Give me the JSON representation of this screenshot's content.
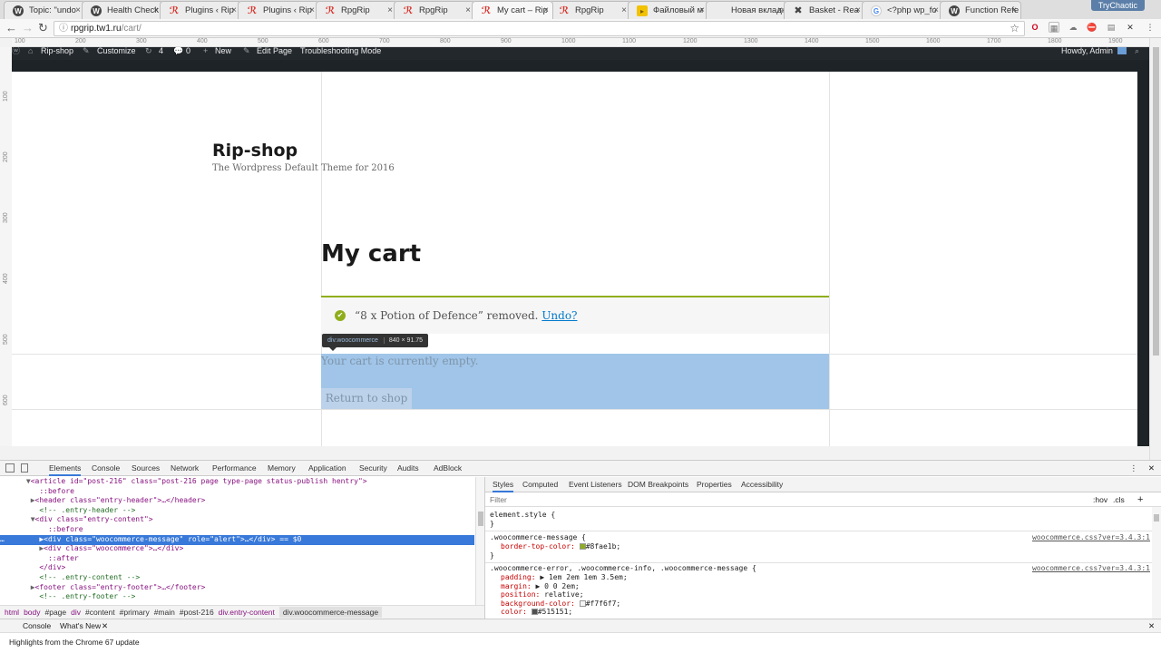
{
  "browser": {
    "tabs": [
      {
        "icon": "wp",
        "label": "Topic: \"undo"
      },
      {
        "icon": "wp",
        "label": "Health Check"
      },
      {
        "icon": "rr",
        "label": "Plugins ‹ Rip"
      },
      {
        "icon": "rr",
        "label": "Plugins ‹ Rip"
      },
      {
        "icon": "rr",
        "label": "RpgRip"
      },
      {
        "icon": "rr",
        "label": "RpgRip"
      },
      {
        "icon": "rr",
        "label": "My cart – Rip"
      },
      {
        "icon": "rr",
        "label": "RpgRip"
      },
      {
        "icon": "ff",
        "label": "Файловый м"
      },
      {
        "icon": "nt",
        "label": "Новая вкладка"
      },
      {
        "icon": "bx",
        "label": "Basket - Rea"
      },
      {
        "icon": "g",
        "label": "<?php wp_fo"
      },
      {
        "icon": "wp",
        "label": "Function Refe"
      }
    ],
    "active_tab_index": 6,
    "user": "TryChaotic",
    "url_host": "rpgrip.tw1.ru",
    "url_path": "/cart/"
  },
  "ruler": {
    "h_ticks": [
      "100",
      "200",
      "300",
      "400",
      "500",
      "600",
      "700",
      "800",
      "900",
      "1000",
      "1100",
      "1200",
      "1300",
      "1400",
      "1500",
      "1600",
      "1700",
      "1800",
      "1900"
    ],
    "v_ticks": [
      "100",
      "200",
      "300",
      "400",
      "500",
      "600"
    ]
  },
  "admin_bar": {
    "site": "Rip-shop",
    "customize": "Customize",
    "updates": "4",
    "comments": "0",
    "new": "New",
    "edit": "Edit Page",
    "troubleshoot": "Troubleshooting Mode",
    "howdy": "Howdy, Admin"
  },
  "site": {
    "title": "Rip-shop",
    "tagline": "The Wordpress Default Theme for 2016"
  },
  "page": {
    "title": "My cart",
    "message_text": "“8 x Potion of Defence” removed.",
    "message_link": "Undo?",
    "empty_text": "Your cart is currently empty.",
    "return_button": "Return to shop"
  },
  "inspect_tooltip": {
    "selector": "div.woocommerce",
    "size": "840 × 91.75"
  },
  "devtools": {
    "tabs": [
      "Elements",
      "Console",
      "Sources",
      "Network",
      "Performance",
      "Memory",
      "Application",
      "Security",
      "Audits",
      "AdBlock"
    ],
    "active_tab": "Elements",
    "dom_lines": [
      {
        "indent": "      ",
        "arrow": "▼",
        "text": "<article id=\"post-216\" class=\"post-216 page type-page status-publish hentry\">",
        "sel": false
      },
      {
        "indent": "        ",
        "arrow": " ",
        "text": "::before",
        "sel": false
      },
      {
        "indent": "       ",
        "arrow": "▶",
        "text": "<header class=\"entry-header\">…</header>",
        "sel": false
      },
      {
        "indent": "        ",
        "arrow": " ",
        "text": "<!-- .entry-header -->",
        "sel": false
      },
      {
        "indent": "       ",
        "arrow": "▼",
        "text": "<div class=\"entry-content\">",
        "sel": false
      },
      {
        "indent": "          ",
        "arrow": " ",
        "text": "::before",
        "sel": false
      },
      {
        "indent": "…        ",
        "arrow": "▶",
        "text": "<div class=\"woocommerce-message\" role=\"alert\">…</div> == $0",
        "sel": true
      },
      {
        "indent": "         ",
        "arrow": "▶",
        "text": "<div class=\"woocommerce\">…</div>",
        "sel": false
      },
      {
        "indent": "          ",
        "arrow": " ",
        "text": "::after",
        "sel": false
      },
      {
        "indent": "        ",
        "arrow": " ",
        "text": "</div>",
        "sel": false
      },
      {
        "indent": "        ",
        "arrow": " ",
        "text": "<!-- .entry-content -->",
        "sel": false
      },
      {
        "indent": "       ",
        "arrow": "▶",
        "text": "<footer class=\"entry-footer\">…</footer>",
        "sel": false
      },
      {
        "indent": "        ",
        "arrow": " ",
        "text": "<!-- .entry-footer -->",
        "sel": false
      }
    ],
    "breadcrumbs": [
      "html",
      "body",
      "#page",
      "div",
      "#content",
      "#primary",
      "#main",
      "#post-216",
      "div.entry-content",
      "div.woocommerce-message"
    ],
    "styles_tabs": [
      "Styles",
      "Computed",
      "Event Listeners",
      "DOM Breakpoints",
      "Properties",
      "Accessibility"
    ],
    "filter_placeholder": "Filter",
    "hov": ":hov",
    "cls": ".cls",
    "rules": {
      "r1_selector": "element.style {",
      "r1_close": "}",
      "r2_selector": ".woocommerce-message {",
      "r2_prop": "border-top-color:",
      "r2_value": "#8fae1b;",
      "r2_close": "}",
      "r2_source": "woocommerce.css?ver=3.4.3:1",
      "r3_selector": ".woocommerce-error, .woocommerce-info, .woocommerce-message {",
      "r3_source": "woocommerce.css?ver=3.4.3:1",
      "r3_props": [
        {
          "p": "padding:",
          "v": "▶ 1em 2em 1em 3.5em;"
        },
        {
          "p": "margin:",
          "v": "▶ 0 0 2em;"
        },
        {
          "p": "position:",
          "v": "relative;"
        },
        {
          "p": "background-color:",
          "v": "#f7f6f7;"
        },
        {
          "p": "color:",
          "v": "#515151;"
        }
      ]
    },
    "drawer_tabs": [
      "Console",
      "What's New"
    ],
    "drawer_text": "Highlights from the Chrome 67 update"
  },
  "colors": {
    "accent_green": "#8fae1b",
    "highlight_blue": "#a0c5e8",
    "link_blue": "#007acc",
    "admin_bar": "#23282d",
    "message_bg": "#f7f6f7",
    "message_text": "#515151"
  }
}
